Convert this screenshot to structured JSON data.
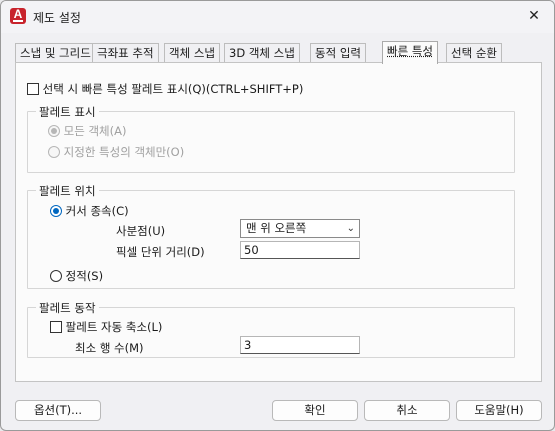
{
  "window": {
    "title": "제도 설정",
    "app_icon_letter": "A",
    "close_glyph": "✕"
  },
  "tabs": [
    {
      "label": "스냅 및 그리드",
      "active": false
    },
    {
      "label": "극좌표 추적",
      "active": false
    },
    {
      "label": "객체 스냅",
      "active": false
    },
    {
      "label": "3D 객체 스냅",
      "active": false
    },
    {
      "label": "동적 입력",
      "active": false
    },
    {
      "label": "빠른 특성",
      "active": true
    },
    {
      "label": "선택 순환",
      "active": false
    }
  ],
  "quick_properties": {
    "show_palette_checkbox_label": "선택 시 빠른 특성 팔레트 표시(Q)(CTRL+SHIFT+P)",
    "show_palette_checked": false,
    "palette_display": {
      "title": "팔레트 표시",
      "all_objects_label": "모든 객체(A)",
      "specified_objects_label": "지정한 특성의 객체만(O)",
      "selected": "all_objects"
    },
    "palette_location": {
      "title": "팔레트 위치",
      "cursor_dependent_label": "커서 종속(C)",
      "quadrant_label": "사분점(U)",
      "quadrant_value": "맨 위 오른쪽",
      "distance_label": "픽셀 단위 거리(D)",
      "distance_value": "50",
      "static_label": "정적(S)",
      "selected": "cursor_dependent"
    },
    "palette_behavior": {
      "title": "팔레트 동작",
      "auto_collapse_label": "팔레트 자동 축소(L)",
      "auto_collapse_checked": false,
      "min_rows_label": "최소 행 수(M)",
      "min_rows_value": "3"
    }
  },
  "buttons": {
    "options": "옵션(T)...",
    "ok": "확인",
    "cancel": "취소",
    "help": "도움말(H)"
  },
  "colors": {
    "accent": "#0067c0",
    "app_icon": "#c8232c"
  }
}
